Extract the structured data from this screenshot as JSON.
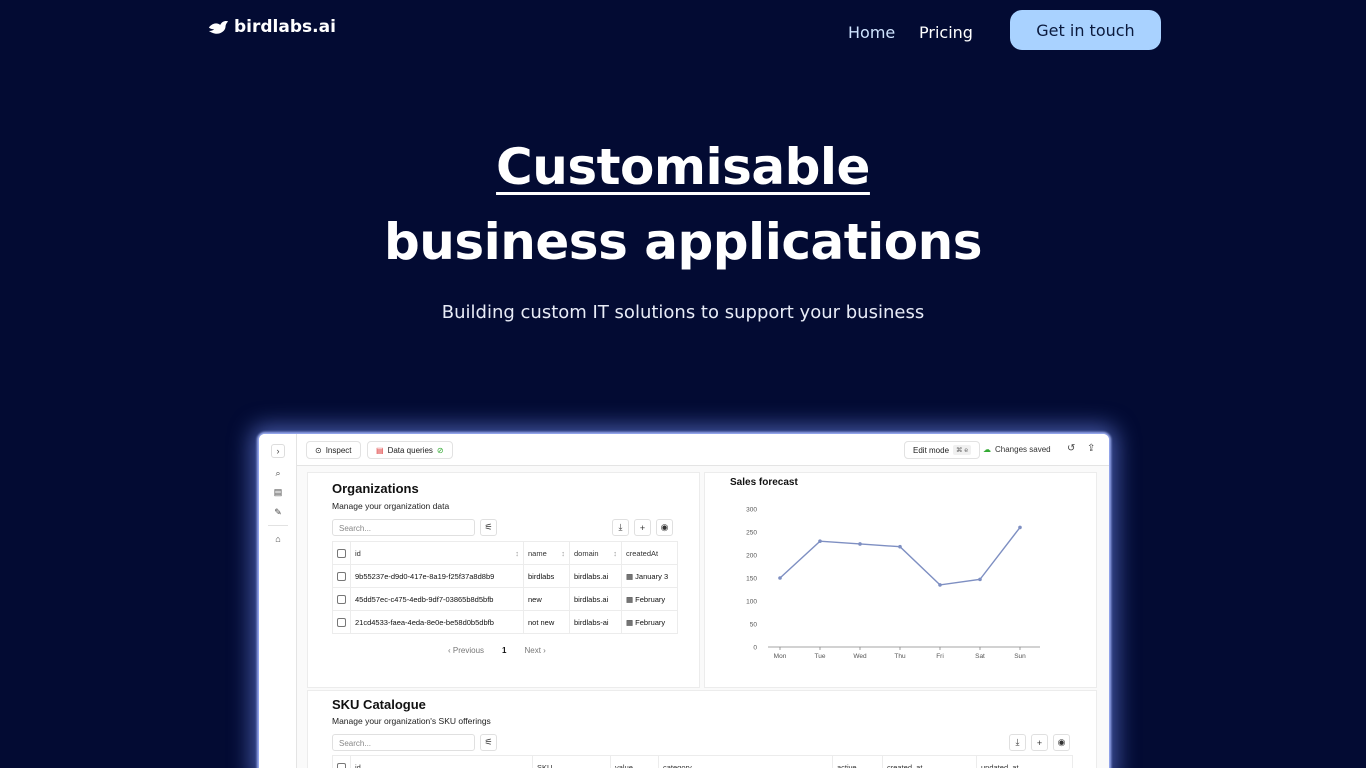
{
  "nav": {
    "brand": "birdlabs.ai",
    "links": [
      "Home",
      "Pricing"
    ],
    "cta": "Get in touch"
  },
  "hero": {
    "title_line1": "Customisable",
    "title_line2": "business applications",
    "subtitle": "Building custom IT solutions to support your business"
  },
  "app": {
    "toolbar": {
      "inspect": "Inspect",
      "data_queries": "Data queries",
      "edit_mode": "Edit mode",
      "shortcut": "⌘ e",
      "status": "Changes saved"
    },
    "organizations": {
      "title": "Organizations",
      "subtitle": "Manage your organization data",
      "search_placeholder": "Search...",
      "columns": [
        "id",
        "name",
        "domain",
        "createdAt"
      ],
      "rows": [
        [
          "9b55237e-d9d0-417e-8a19-f25f37a8d8b9",
          "birdlabs",
          "birdlabs.ai",
          "January 3"
        ],
        [
          "45dd57ec-c475-4edb-9df7-03865b8d5bfb",
          "new",
          "birdlabs.ai",
          "February"
        ],
        [
          "21cd4533-faea-4eda-8e0e-be58d0b5dbfb",
          "not new",
          "birdlabs-ai",
          "February"
        ]
      ],
      "pager": {
        "prev": "Previous",
        "page": "1",
        "next": "Next"
      }
    },
    "sku": {
      "title": "SKU Catalogue",
      "subtitle": "Manage your organization's SKU offerings",
      "search_placeholder": "Search...",
      "columns": [
        "id",
        "SKU",
        "value",
        "category",
        "active",
        "created_at",
        "updated_at"
      ]
    }
  },
  "chart_data": {
    "type": "line",
    "title": "Sales forecast",
    "categories": [
      "Mon",
      "Tue",
      "Wed",
      "Thu",
      "Fri",
      "Sat",
      "Sun"
    ],
    "values": [
      150,
      230,
      224,
      218,
      135,
      147,
      260
    ],
    "ylim": [
      0,
      300
    ],
    "yticks": [
      0,
      50,
      100,
      150,
      200,
      250,
      300
    ],
    "color": "#7e8fc2",
    "grid": false
  }
}
